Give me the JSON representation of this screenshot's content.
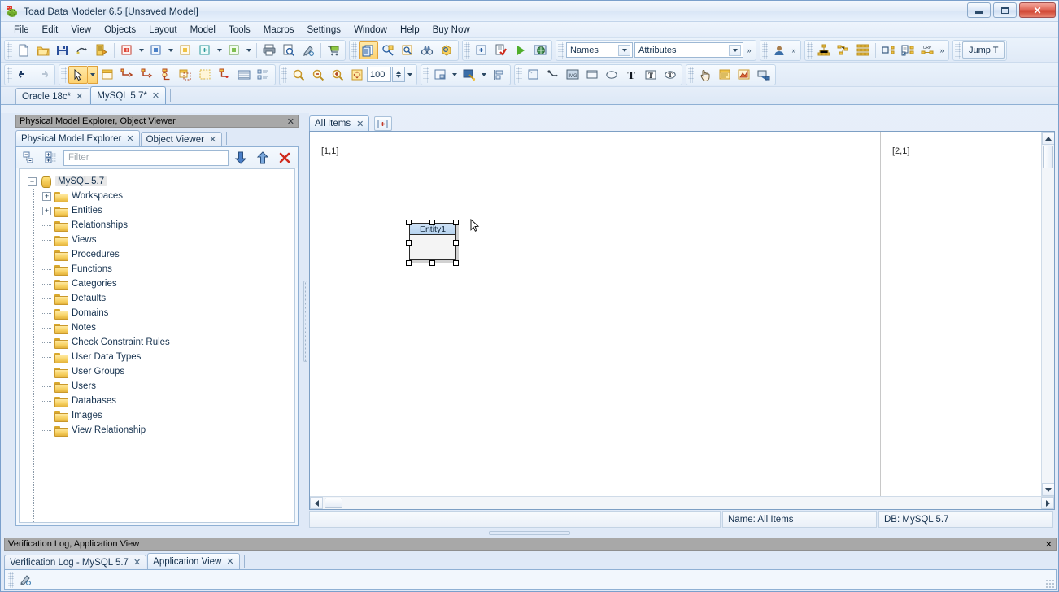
{
  "window": {
    "title": "Toad Data Modeler 6.5 [Unsaved Model]",
    "app_icon": "toad-frog-icon",
    "minimize_label": "",
    "maximize_label": "",
    "close_label": "✕"
  },
  "menubar": {
    "items": [
      {
        "label": "File"
      },
      {
        "label": "Edit"
      },
      {
        "label": "View"
      },
      {
        "label": "Objects"
      },
      {
        "label": "Layout"
      },
      {
        "label": "Model"
      },
      {
        "label": "Tools"
      },
      {
        "label": "Macros"
      },
      {
        "label": "Settings"
      },
      {
        "label": "Window"
      },
      {
        "label": "Help"
      },
      {
        "label": "Buy Now"
      }
    ]
  },
  "toolbar_main": {
    "names_combo": {
      "value": "Names"
    },
    "attributes_combo": {
      "value": "Attributes"
    },
    "jump_button": {
      "label": "Jump T"
    },
    "overflow_label": "»"
  },
  "toolbar_second": {
    "zoom_value": "100"
  },
  "model_tabs": {
    "items": [
      {
        "label": "Oracle 18c*",
        "active": false,
        "close": "✕"
      },
      {
        "label": "MySQL 5.7*",
        "active": true,
        "close": "✕"
      }
    ]
  },
  "left_panel": {
    "caption": "Physical Model Explorer, Object Viewer",
    "caption_close": "✕",
    "tabs": [
      {
        "label": "Physical Model Explorer",
        "active": true,
        "close": "✕"
      },
      {
        "label": "Object Viewer",
        "active": false,
        "close": "✕"
      }
    ],
    "filter": {
      "placeholder": "Filter",
      "value": ""
    },
    "tree": {
      "root": {
        "label": "MySQL 5.7",
        "expander": "−",
        "icon": "database-icon"
      },
      "items": [
        {
          "label": "Workspaces",
          "expander": "+",
          "icon": "folder-icon"
        },
        {
          "label": "Entities",
          "expander": "+",
          "icon": "folder-icon"
        },
        {
          "label": "Relationships",
          "expander": "",
          "icon": "folder-icon"
        },
        {
          "label": "Views",
          "expander": "",
          "icon": "folder-icon"
        },
        {
          "label": "Procedures",
          "expander": "",
          "icon": "folder-icon"
        },
        {
          "label": "Functions",
          "expander": "",
          "icon": "folder-icon"
        },
        {
          "label": "Categories",
          "expander": "",
          "icon": "folder-icon"
        },
        {
          "label": "Defaults",
          "expander": "",
          "icon": "folder-icon"
        },
        {
          "label": "Domains",
          "expander": "",
          "icon": "folder-icon"
        },
        {
          "label": "Notes",
          "expander": "",
          "icon": "folder-icon"
        },
        {
          "label": "Check Constraint Rules",
          "expander": "",
          "icon": "folder-icon"
        },
        {
          "label": "User Data Types",
          "expander": "",
          "icon": "folder-icon"
        },
        {
          "label": "User Groups",
          "expander": "",
          "icon": "folder-icon"
        },
        {
          "label": "Users",
          "expander": "",
          "icon": "folder-icon"
        },
        {
          "label": "Databases",
          "expander": "",
          "icon": "folder-icon"
        },
        {
          "label": "Images",
          "expander": "",
          "icon": "folder-icon"
        },
        {
          "label": "View Relationship",
          "expander": "",
          "icon": "folder-icon"
        }
      ]
    }
  },
  "canvas": {
    "tabs": [
      {
        "label": "All Items",
        "active": true,
        "close": "✕"
      }
    ],
    "add_tab_icon": "new-workspace-icon",
    "page_markers": [
      {
        "label": "[1,1]"
      },
      {
        "label": "[2,1]"
      }
    ],
    "entities": [
      {
        "name": "Entity1",
        "selected": true
      }
    ]
  },
  "statusbar": {
    "name_field": "Name: All Items",
    "db_field": "DB: MySQL 5.7"
  },
  "bottom_panel": {
    "caption": "Verification Log, Application View",
    "caption_close": "✕",
    "tabs": [
      {
        "label": "Verification Log - MySQL 5.7",
        "active": false,
        "close": "✕"
      },
      {
        "label": "Application View",
        "active": true,
        "close": "✕"
      }
    ]
  },
  "colors": {
    "accent": "#fdd271",
    "entity_title": "#b6d3ef",
    "panel_caption": "#a8a8a8",
    "folder": "#f6cf5e"
  }
}
